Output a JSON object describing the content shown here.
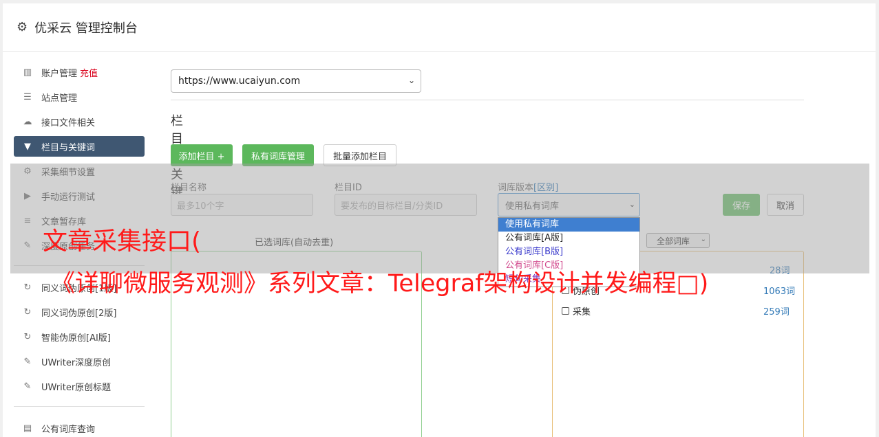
{
  "header": {
    "title": "优采云 管理控制台",
    "icon": "gear-icon"
  },
  "sidebar": {
    "items": [
      {
        "label": "账户管理",
        "badge": "充值",
        "icon": "bar-chart-icon"
      },
      {
        "label": "站点管理",
        "icon": "server-icon"
      },
      {
        "label": "接口文件相关",
        "icon": "cloud-upload-icon"
      },
      {
        "label": "栏目与关键词",
        "icon": "filter-icon",
        "active": true
      },
      {
        "label": "采集细节设置",
        "icon": "cogs-icon"
      },
      {
        "label": "手动运行测试",
        "icon": "play-icon"
      },
      {
        "label": "文章暂存库",
        "icon": "database-icon"
      },
      {
        "label": "深度原创任务",
        "icon": "edit-icon"
      },
      {
        "label": "同义词伪原创[1版]",
        "icon": "refresh-icon"
      },
      {
        "label": "同义词伪原创[2版]",
        "icon": "refresh-icon"
      },
      {
        "label": "智能伪原创[AI版]",
        "icon": "refresh-icon"
      },
      {
        "label": "UWriter深度原创",
        "icon": "edit-icon"
      },
      {
        "label": "UWriter原创标题",
        "icon": "edit-icon"
      },
      {
        "label": "公有词库查询",
        "icon": "book-icon"
      }
    ]
  },
  "main": {
    "site_select": "https://www.ucaiyun.com",
    "section_title": "栏目与关键词",
    "buttons": {
      "add_column": "添加栏目 +",
      "private_lib": "私有词库管理",
      "batch_add": "批量添加栏目"
    },
    "form": {
      "column_name_label": "栏目名称",
      "column_name_placeholder": "最多10个字",
      "column_id_label": "栏目ID",
      "column_id_placeholder": "要发布的目标栏目/分类ID",
      "lib_version_label": "词库版本",
      "lib_version_link": "[区别]",
      "lib_version_value": "使用私有词库",
      "save": "保存",
      "cancel": "取消"
    },
    "dropdown_options": [
      "使用私有词库",
      "公有词库[A版]",
      "公有词库[B版]",
      "公有词库[C版]",
      "短句采集"
    ],
    "selected_libs_label": "已选词库(自动去重)",
    "all_libs_select": "全部词库",
    "libs": [
      {
        "name": "伪原创",
        "count": "1063词"
      },
      {
        "name": "采集",
        "count": "259词"
      }
    ],
    "partial_count": "28词"
  },
  "watermark": {
    "line1": "文章采集接口(",
    "line2": "《详聊微服务观测》系列文章：Telegraf架构设计并发编程□)"
  },
  "colors": {
    "active_nav": "#3f5772",
    "green_button": "#5cb85c",
    "accent_red": "#d9001b"
  }
}
